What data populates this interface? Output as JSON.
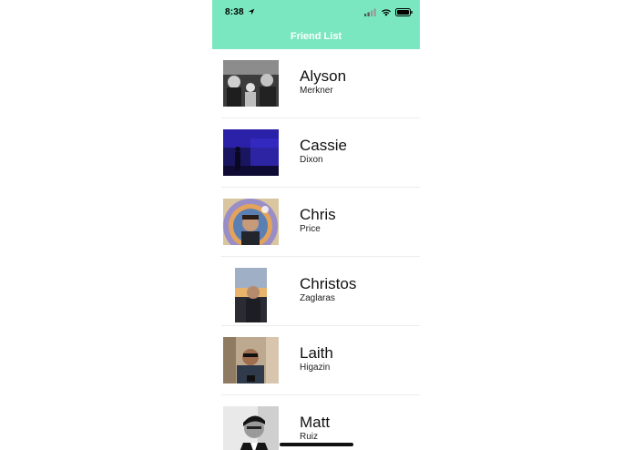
{
  "status_bar": {
    "time": "8:38"
  },
  "nav": {
    "title": "Friend List"
  },
  "friends": [
    {
      "first": "Alyson",
      "last": "Merkner"
    },
    {
      "first": "Cassie",
      "last": "Dixon"
    },
    {
      "first": "Chris",
      "last": "Price"
    },
    {
      "first": "Christos",
      "last": "Zaglaras"
    },
    {
      "first": "Laith",
      "last": "Higazin"
    },
    {
      "first": "Matt",
      "last": "Ruiz"
    }
  ],
  "colors": {
    "accent": "#7ae7c1"
  }
}
